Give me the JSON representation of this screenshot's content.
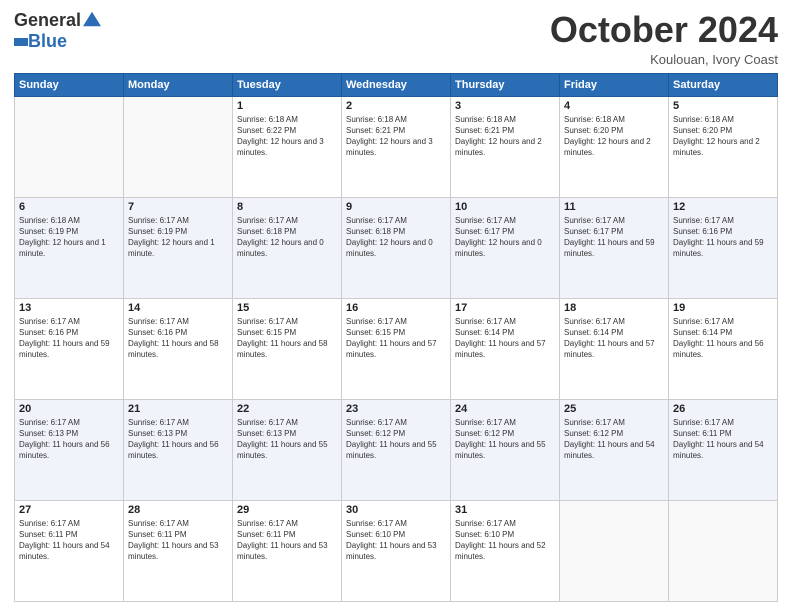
{
  "logo": {
    "general": "General",
    "blue": "Blue"
  },
  "title": "October 2024",
  "location": "Koulouan, Ivory Coast",
  "days_of_week": [
    "Sunday",
    "Monday",
    "Tuesday",
    "Wednesday",
    "Thursday",
    "Friday",
    "Saturday"
  ],
  "weeks": [
    [
      {
        "day": "",
        "info": ""
      },
      {
        "day": "",
        "info": ""
      },
      {
        "day": "1",
        "info": "Sunrise: 6:18 AM\nSunset: 6:22 PM\nDaylight: 12 hours and 3 minutes."
      },
      {
        "day": "2",
        "info": "Sunrise: 6:18 AM\nSunset: 6:21 PM\nDaylight: 12 hours and 3 minutes."
      },
      {
        "day": "3",
        "info": "Sunrise: 6:18 AM\nSunset: 6:21 PM\nDaylight: 12 hours and 2 minutes."
      },
      {
        "day": "4",
        "info": "Sunrise: 6:18 AM\nSunset: 6:20 PM\nDaylight: 12 hours and 2 minutes."
      },
      {
        "day": "5",
        "info": "Sunrise: 6:18 AM\nSunset: 6:20 PM\nDaylight: 12 hours and 2 minutes."
      }
    ],
    [
      {
        "day": "6",
        "info": "Sunrise: 6:18 AM\nSunset: 6:19 PM\nDaylight: 12 hours and 1 minute."
      },
      {
        "day": "7",
        "info": "Sunrise: 6:17 AM\nSunset: 6:19 PM\nDaylight: 12 hours and 1 minute."
      },
      {
        "day": "8",
        "info": "Sunrise: 6:17 AM\nSunset: 6:18 PM\nDaylight: 12 hours and 0 minutes."
      },
      {
        "day": "9",
        "info": "Sunrise: 6:17 AM\nSunset: 6:18 PM\nDaylight: 12 hours and 0 minutes."
      },
      {
        "day": "10",
        "info": "Sunrise: 6:17 AM\nSunset: 6:17 PM\nDaylight: 12 hours and 0 minutes."
      },
      {
        "day": "11",
        "info": "Sunrise: 6:17 AM\nSunset: 6:17 PM\nDaylight: 11 hours and 59 minutes."
      },
      {
        "day": "12",
        "info": "Sunrise: 6:17 AM\nSunset: 6:16 PM\nDaylight: 11 hours and 59 minutes."
      }
    ],
    [
      {
        "day": "13",
        "info": "Sunrise: 6:17 AM\nSunset: 6:16 PM\nDaylight: 11 hours and 59 minutes."
      },
      {
        "day": "14",
        "info": "Sunrise: 6:17 AM\nSunset: 6:16 PM\nDaylight: 11 hours and 58 minutes."
      },
      {
        "day": "15",
        "info": "Sunrise: 6:17 AM\nSunset: 6:15 PM\nDaylight: 11 hours and 58 minutes."
      },
      {
        "day": "16",
        "info": "Sunrise: 6:17 AM\nSunset: 6:15 PM\nDaylight: 11 hours and 57 minutes."
      },
      {
        "day": "17",
        "info": "Sunrise: 6:17 AM\nSunset: 6:14 PM\nDaylight: 11 hours and 57 minutes."
      },
      {
        "day": "18",
        "info": "Sunrise: 6:17 AM\nSunset: 6:14 PM\nDaylight: 11 hours and 57 minutes."
      },
      {
        "day": "19",
        "info": "Sunrise: 6:17 AM\nSunset: 6:14 PM\nDaylight: 11 hours and 56 minutes."
      }
    ],
    [
      {
        "day": "20",
        "info": "Sunrise: 6:17 AM\nSunset: 6:13 PM\nDaylight: 11 hours and 56 minutes."
      },
      {
        "day": "21",
        "info": "Sunrise: 6:17 AM\nSunset: 6:13 PM\nDaylight: 11 hours and 56 minutes."
      },
      {
        "day": "22",
        "info": "Sunrise: 6:17 AM\nSunset: 6:13 PM\nDaylight: 11 hours and 55 minutes."
      },
      {
        "day": "23",
        "info": "Sunrise: 6:17 AM\nSunset: 6:12 PM\nDaylight: 11 hours and 55 minutes."
      },
      {
        "day": "24",
        "info": "Sunrise: 6:17 AM\nSunset: 6:12 PM\nDaylight: 11 hours and 55 minutes."
      },
      {
        "day": "25",
        "info": "Sunrise: 6:17 AM\nSunset: 6:12 PM\nDaylight: 11 hours and 54 minutes."
      },
      {
        "day": "26",
        "info": "Sunrise: 6:17 AM\nSunset: 6:11 PM\nDaylight: 11 hours and 54 minutes."
      }
    ],
    [
      {
        "day": "27",
        "info": "Sunrise: 6:17 AM\nSunset: 6:11 PM\nDaylight: 11 hours and 54 minutes."
      },
      {
        "day": "28",
        "info": "Sunrise: 6:17 AM\nSunset: 6:11 PM\nDaylight: 11 hours and 53 minutes."
      },
      {
        "day": "29",
        "info": "Sunrise: 6:17 AM\nSunset: 6:11 PM\nDaylight: 11 hours and 53 minutes."
      },
      {
        "day": "30",
        "info": "Sunrise: 6:17 AM\nSunset: 6:10 PM\nDaylight: 11 hours and 53 minutes."
      },
      {
        "day": "31",
        "info": "Sunrise: 6:17 AM\nSunset: 6:10 PM\nDaylight: 11 hours and 52 minutes."
      },
      {
        "day": "",
        "info": ""
      },
      {
        "day": "",
        "info": ""
      }
    ]
  ]
}
